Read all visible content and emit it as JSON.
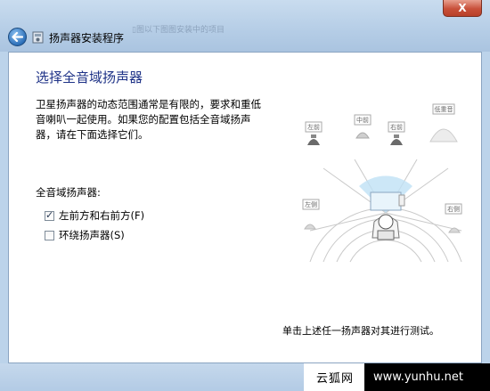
{
  "window": {
    "title": "扬声器安装程序",
    "close_label": "X",
    "background_title": "▯图以下图图安装中的项目"
  },
  "page": {
    "heading": "选择全音域扬声器",
    "description": "卫星扬声器的动态范围通常是有限的，要求和重低音喇叭一起使用。如果您的配置包括全音域扬声器，请在下面选择它们。",
    "group_label": "全音域扬声器:",
    "options": [
      {
        "label": "左前方和右前方(F)",
        "checked": true
      },
      {
        "label": "环绕扬声器(S)",
        "checked": false
      }
    ],
    "hint": "单击上述任一扬声器对其进行测试。"
  },
  "diagram": {
    "front_left": "左前",
    "center": "中前",
    "front_right": "右前",
    "subwoofer": "低重音",
    "side_left": "左侧",
    "side_right": "右侧"
  },
  "watermark": {
    "left": "云狐网",
    "right": "www.yunhu.net"
  },
  "colors": {
    "heading": "#1e3287",
    "close": "#c8503a",
    "frame": "#bcd3ea"
  }
}
